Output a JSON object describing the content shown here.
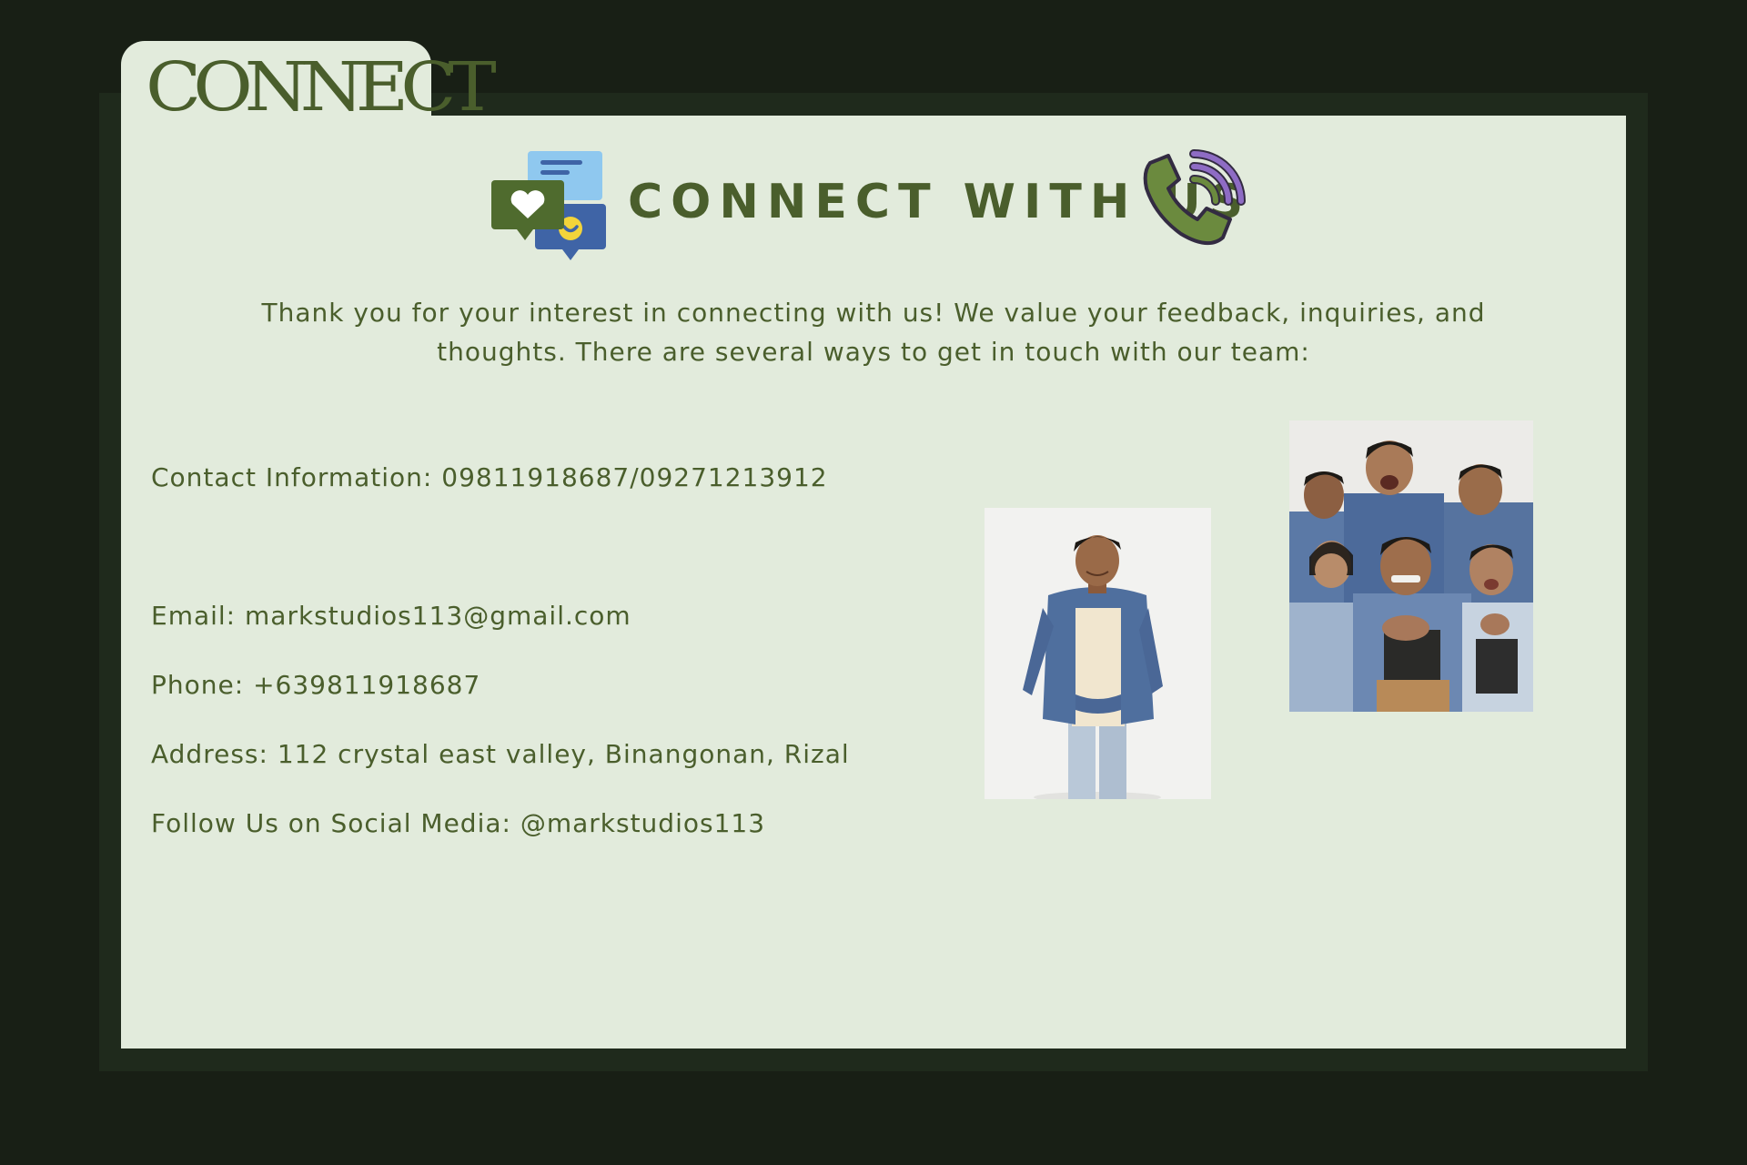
{
  "tab": {
    "title": "CONNECT"
  },
  "header": {
    "title": "CONNECT WITH US",
    "icons": [
      "chat-bubbles-icon",
      "phone-ringing-icon"
    ]
  },
  "intro": {
    "text": "Thank you for your interest in connecting with us! We value your feedback, inquiries, and thoughts. There are several ways to get in touch with our team:"
  },
  "contact": {
    "contact_info": "Contact Information: 09811918687/09271213912",
    "email": "Email: markstudios113@gmail.com",
    "phone": "Phone: +639811918687",
    "address": "Address: 112 crystal east valley, Binangonan, Rizal",
    "social": "Follow Us on Social Media: @markstudios113"
  },
  "colors": {
    "background": "#181f15",
    "frame": "#1f2a1c",
    "card": "#e2ebdc",
    "text": "#4a5e2c",
    "icon_green": "#4f6b2e",
    "icon_blue": "#3f64a6",
    "icon_light_blue": "#8fc8ef",
    "icon_purple": "#8e6cc4",
    "icon_yellow": "#f3d43a"
  }
}
